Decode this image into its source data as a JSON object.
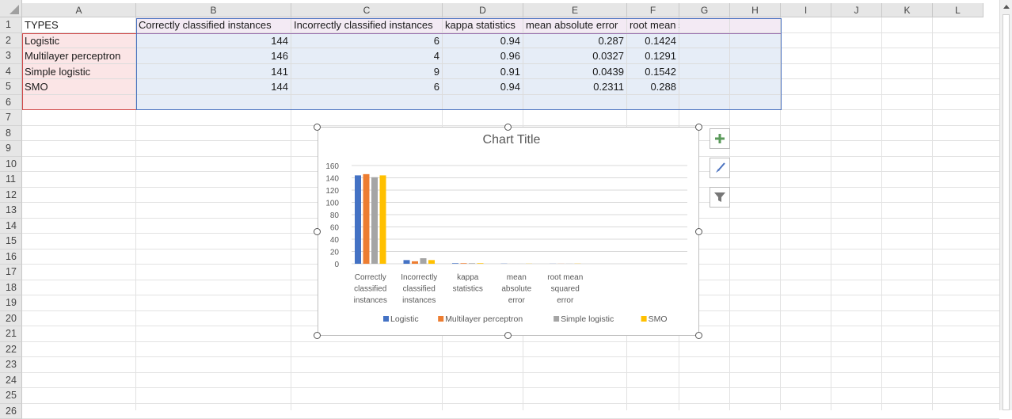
{
  "columns": [
    "A",
    "B",
    "C",
    "D",
    "E",
    "F",
    "G",
    "H",
    "I",
    "J",
    "K",
    "L"
  ],
  "rows": [
    "1",
    "2",
    "3",
    "4",
    "5",
    "6",
    "7",
    "8",
    "9",
    "10",
    "11",
    "12",
    "13",
    "14",
    "15",
    "16",
    "17",
    "18",
    "19",
    "20",
    "21",
    "22",
    "23",
    "24",
    "25",
    "26"
  ],
  "table": {
    "headers": [
      "TYPES",
      "Correctly classified instances",
      "Incorrectly classified instances",
      "kappa statistics",
      "mean absolute error",
      "root mean squared error"
    ],
    "data": [
      [
        "Logistic",
        "144",
        "6",
        "0.94",
        "0.287",
        "0.1424"
      ],
      [
        "Multilayer perceptron",
        "146",
        "4",
        "0.96",
        "0.0327",
        "0.1291"
      ],
      [
        "Simple logistic",
        "141",
        "9",
        "0.91",
        "0.0439",
        "0.1542"
      ],
      [
        "SMO",
        "144",
        "6",
        "0.94",
        "0.2311",
        "0.288"
      ]
    ]
  },
  "chart_data": {
    "type": "bar",
    "title": "Chart Title",
    "categories": [
      [
        "Correctly",
        "classified",
        "instances"
      ],
      [
        "Incorrectly",
        "classified",
        "instances"
      ],
      [
        "kappa",
        "statistics"
      ],
      [
        "mean",
        "absolute",
        "error"
      ],
      [
        "root mean",
        "squared",
        "error"
      ]
    ],
    "series": [
      {
        "name": "Logistic",
        "color": "#4472c4",
        "values": [
          144,
          6,
          0.94,
          0.287,
          0.1424
        ]
      },
      {
        "name": "Multilayer perceptron",
        "color": "#ed7d31",
        "values": [
          146,
          4,
          0.96,
          0.0327,
          0.1291
        ]
      },
      {
        "name": "Simple logistic",
        "color": "#a5a5a5",
        "values": [
          141,
          9,
          0.91,
          0.0439,
          0.1542
        ]
      },
      {
        "name": "SMO",
        "color": "#ffc000",
        "values": [
          144,
          6,
          0.94,
          0.2311,
          0.288
        ]
      }
    ],
    "ylim": [
      0,
      160
    ],
    "yticks": [
      "0",
      "20",
      "40",
      "60",
      "80",
      "100",
      "120",
      "140",
      "160"
    ],
    "grid": true,
    "legend": "bottom"
  },
  "chart_tools": {
    "add": "chart-elements-icon",
    "style": "chart-styles-icon",
    "filter": "chart-filters-icon"
  }
}
